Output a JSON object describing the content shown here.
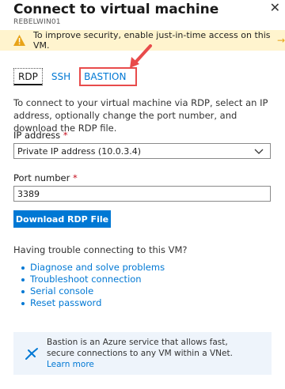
{
  "header": {
    "title": "Connect to virtual machine",
    "subtitle": "REBELWIN01",
    "close": "✕"
  },
  "warning": {
    "text": "To improve security, enable just-in-time access on this VM.",
    "arrow": "→"
  },
  "tabs": [
    {
      "label": "RDP"
    },
    {
      "label": "SSH"
    },
    {
      "label": "BASTION"
    }
  ],
  "description": "To connect to your virtual machine via RDP, select an IP address, optionally change the port number, and download the RDP file.",
  "ip": {
    "label": "IP address",
    "required": "*",
    "value": "Private IP address (10.0.3.4)"
  },
  "port": {
    "label": "Port number",
    "required": "*",
    "value": "3389"
  },
  "download_button": "Download RDP File",
  "trouble": {
    "heading": "Having trouble connecting to this VM?",
    "links": [
      "Diagnose and solve problems",
      "Troubleshoot connection",
      "Serial console",
      "Reset password"
    ]
  },
  "bastion_info": {
    "text": "Bastion is an Azure service that allows fast, secure connections to any VM within a VNet.",
    "link": "Learn more"
  }
}
